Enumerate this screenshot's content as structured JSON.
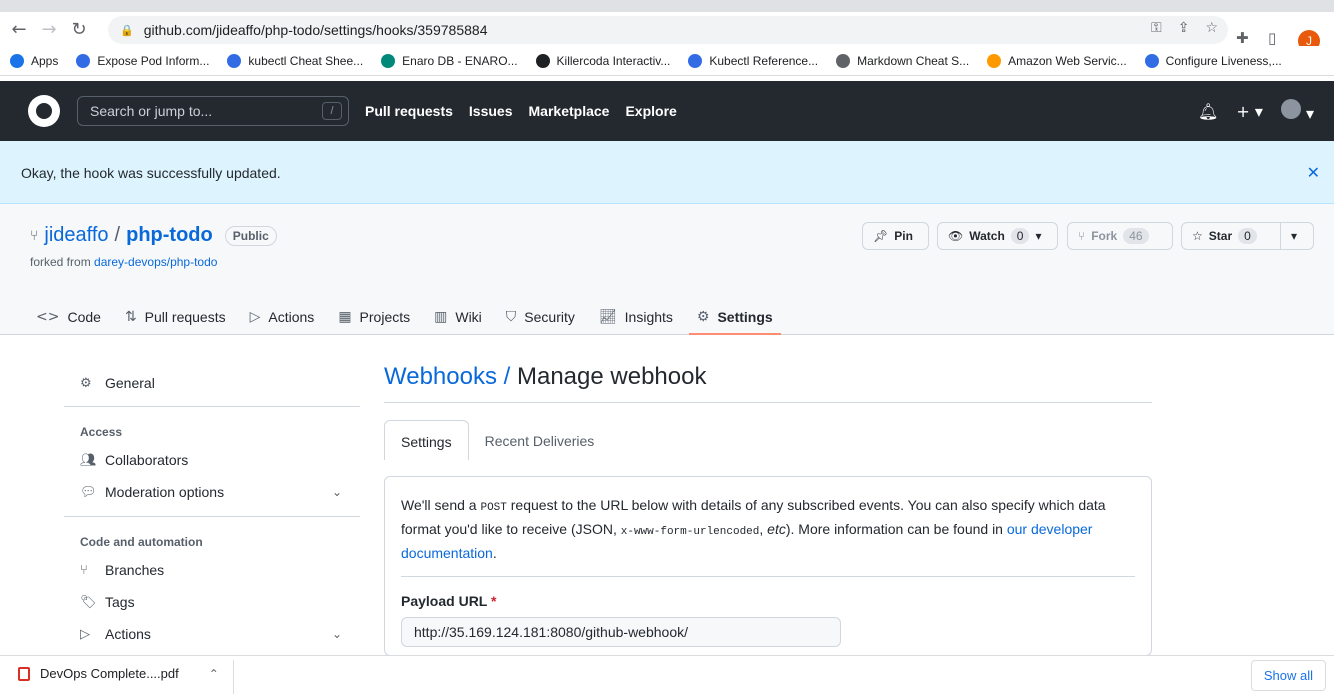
{
  "browser": {
    "url": "github.com/jideaffo/php-todo/settings/hooks/359785884",
    "profile_initial": "J",
    "bookmarks": [
      {
        "label": "Apps",
        "color": "#1a73e8"
      },
      {
        "label": "Expose Pod Inform...",
        "color": "#326ce5"
      },
      {
        "label": "kubectl Cheat Shee...",
        "color": "#326ce5"
      },
      {
        "label": "Enaro DB - ENARO...",
        "color": "#00897b"
      },
      {
        "label": "Killercoda Interactiv...",
        "color": "#202124"
      },
      {
        "label": "Kubectl Reference...",
        "color": "#326ce5"
      },
      {
        "label": "Markdown Cheat S...",
        "color": "#5f6368"
      },
      {
        "label": "Amazon Web Servic...",
        "color": "#ff9900"
      },
      {
        "label": "Configure Liveness,...",
        "color": "#326ce5"
      }
    ]
  },
  "header": {
    "search_placeholder": "Search or jump to...",
    "slash": "/",
    "nav": [
      "Pull requests",
      "Issues",
      "Marketplace",
      "Explore"
    ]
  },
  "flash": {
    "message": "Okay, the hook was successfully updated.",
    "close": "✕"
  },
  "repo": {
    "owner": "jideaffo",
    "separator": "/",
    "name": "php-todo",
    "visibility": "Public",
    "forked_prefix": "forked from",
    "forked_from": "darey-devops/php-todo",
    "pin": "Pin",
    "watch": "Watch",
    "watch_count": "0",
    "fork": "Fork",
    "fork_count": "46",
    "star": "Star",
    "star_count": "0",
    "tabs": [
      "Code",
      "Pull requests",
      "Actions",
      "Projects",
      "Wiki",
      "Security",
      "Insights",
      "Settings"
    ]
  },
  "sidebar": {
    "general": "General",
    "access_heading": "Access",
    "collaborators": "Collaborators",
    "moderation": "Moderation options",
    "code_heading": "Code and automation",
    "branches": "Branches",
    "tags": "Tags",
    "actions": "Actions"
  },
  "main": {
    "crumb_link": "Webhooks",
    "crumb_sep": "/",
    "title": "Manage webhook",
    "tab_settings": "Settings",
    "tab_deliveries": "Recent Deliveries",
    "desc_1": "We'll send a ",
    "desc_post": "POST",
    "desc_2": " request to the URL below with details of any subscribed events. You can also specify which data format you'd like to receive (JSON, ",
    "desc_code": "x-www-form-urlencoded",
    "desc_3": ", ",
    "desc_etc": "etc",
    "desc_4": "). More information can be found in ",
    "desc_link": "our developer documentation",
    "desc_end": ".",
    "payload_label": "Payload URL",
    "required": "*",
    "payload_value": "http://35.169.124.181:8080/github-webhook/"
  },
  "downloads": {
    "file": "DevOps Complete....pdf",
    "show_all": "Show all"
  }
}
